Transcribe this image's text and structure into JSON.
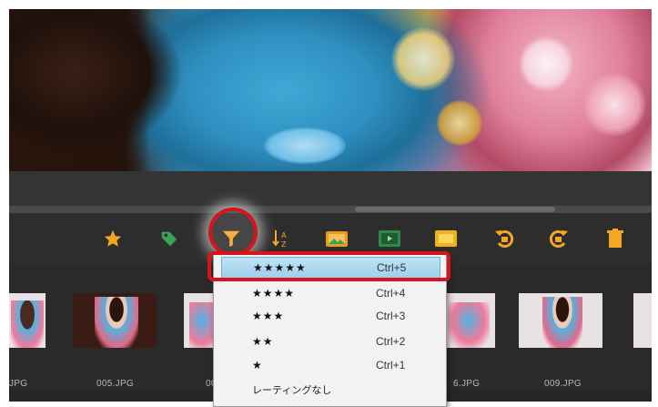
{
  "toolbar": {
    "icons": [
      "star-icon",
      "tag-icon",
      "filter-icon",
      "sort-icon",
      "folder-image-icon",
      "slideshow-icon",
      "frame-icon",
      "rotate-left-icon",
      "rotate-right-icon",
      "trash-icon"
    ],
    "accent_color": "#f5a623"
  },
  "filmstrip": {
    "labels": [
      "JPG",
      "005.JPG",
      "00",
      "6.JPG",
      "009.JPG"
    ]
  },
  "rating_menu": {
    "items": [
      {
        "stars": "★★★★★",
        "shortcut": "Ctrl+5",
        "selected": true
      },
      {
        "stars": "★★★★",
        "shortcut": "Ctrl+4",
        "selected": false
      },
      {
        "stars": "★★★",
        "shortcut": "Ctrl+3",
        "selected": false
      },
      {
        "stars": "★★",
        "shortcut": "Ctrl+2",
        "selected": false
      },
      {
        "stars": "★",
        "shortcut": "Ctrl+1",
        "selected": false
      }
    ],
    "no_rating_label": "レーティングなし"
  },
  "highlight_color": "#d7141d"
}
